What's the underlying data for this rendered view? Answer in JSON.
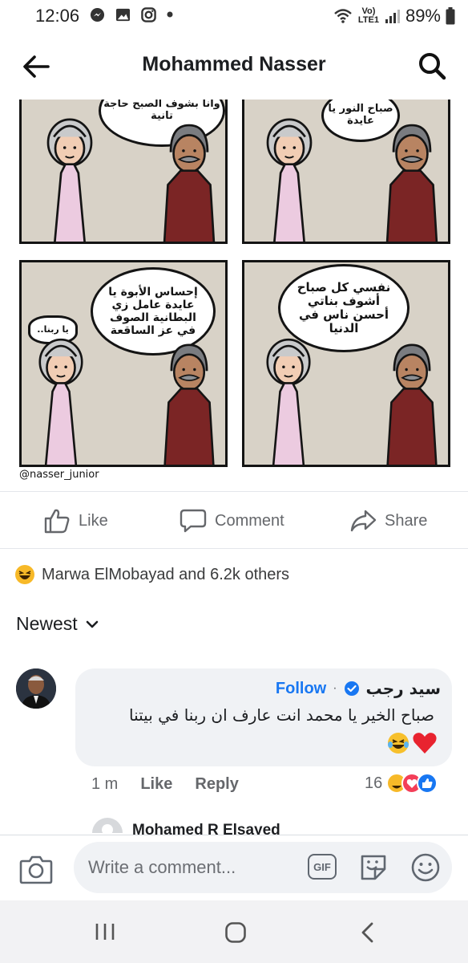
{
  "status_bar": {
    "time": "12:06",
    "network_label": "Vo) LTE1",
    "battery": "89%"
  },
  "header": {
    "title": "Mohammed Nasser",
    "back_icon": "back-arrow-icon",
    "search_icon": "search-icon"
  },
  "post": {
    "comic": {
      "panel1_text": "وأنا بشوف الصبح حاجة تانية",
      "panel2_text": "صباح النور يا عايدة",
      "panel3_text": "إحساس الأبوة يا عايدة عامل زي البطانية الصوف في عز الساقعة",
      "panel3_small": "يا ربنا..",
      "panel4_text": "نفسي كل صباح أشوف بناتي أحسن ناس في الدنيا",
      "signature": "@nasser_junior"
    },
    "actions": {
      "like": "Like",
      "comment": "Comment",
      "share": "Share"
    },
    "reactions_summary": "Marwa ElMobayad and 6.2k others"
  },
  "comments": {
    "sort_label": "Newest",
    "items": [
      {
        "author": "سيد رجب",
        "follow_label": "Follow",
        "text": "صباح الخير يا محمد انت عارف ان ربنا في بيتنا",
        "time": "1 m",
        "like_label": "Like",
        "reply_label": "Reply",
        "reaction_count": "16"
      }
    ],
    "next_author_partial": "Mohamed R Elsayed"
  },
  "composer": {
    "placeholder": "Write a comment...",
    "gif_label": "GIF"
  },
  "colors": {
    "accent": "#1877f2",
    "secondary_text": "#65676b",
    "bubble_bg": "#f0f2f5"
  }
}
